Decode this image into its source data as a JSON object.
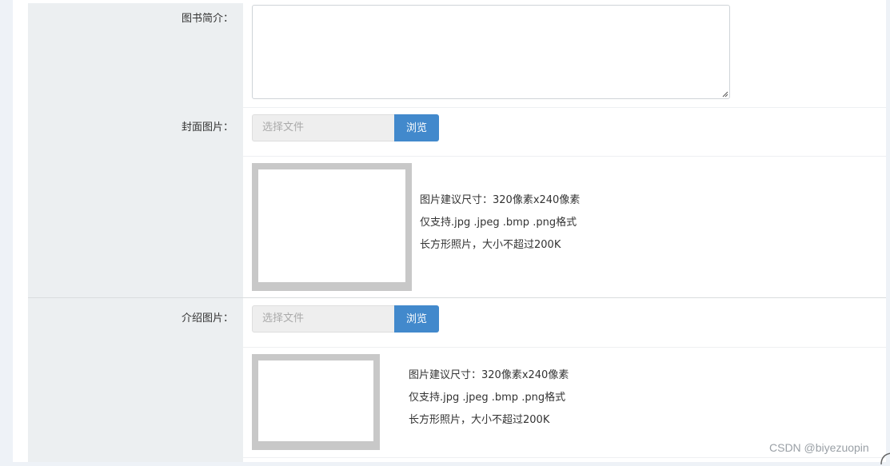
{
  "form": {
    "intro_label": "图书简介：",
    "cover": {
      "label": "封面图片：",
      "file_placeholder": "选择文件",
      "browse_label": "浏览",
      "hints": [
        "图片建议尺寸：320像素x240像素",
        "仅支持.jpg .jpeg .bmp .png格式",
        "长方形照片，大小不超过200K"
      ]
    },
    "intro_image": {
      "label": "介绍图片：",
      "file_placeholder": "选择文件",
      "browse_label": "浏览",
      "hints": [
        "图片建议尺寸：320像素x240像素",
        "仅支持.jpg .jpeg .bmp .png格式",
        "长方形照片，大小不超过200K"
      ]
    }
  },
  "watermark": "CSDN @biyezuopin",
  "colors": {
    "accent": "#4289cc",
    "label_bg": "#eceff1",
    "preview_frame": "#c8c8c8"
  }
}
